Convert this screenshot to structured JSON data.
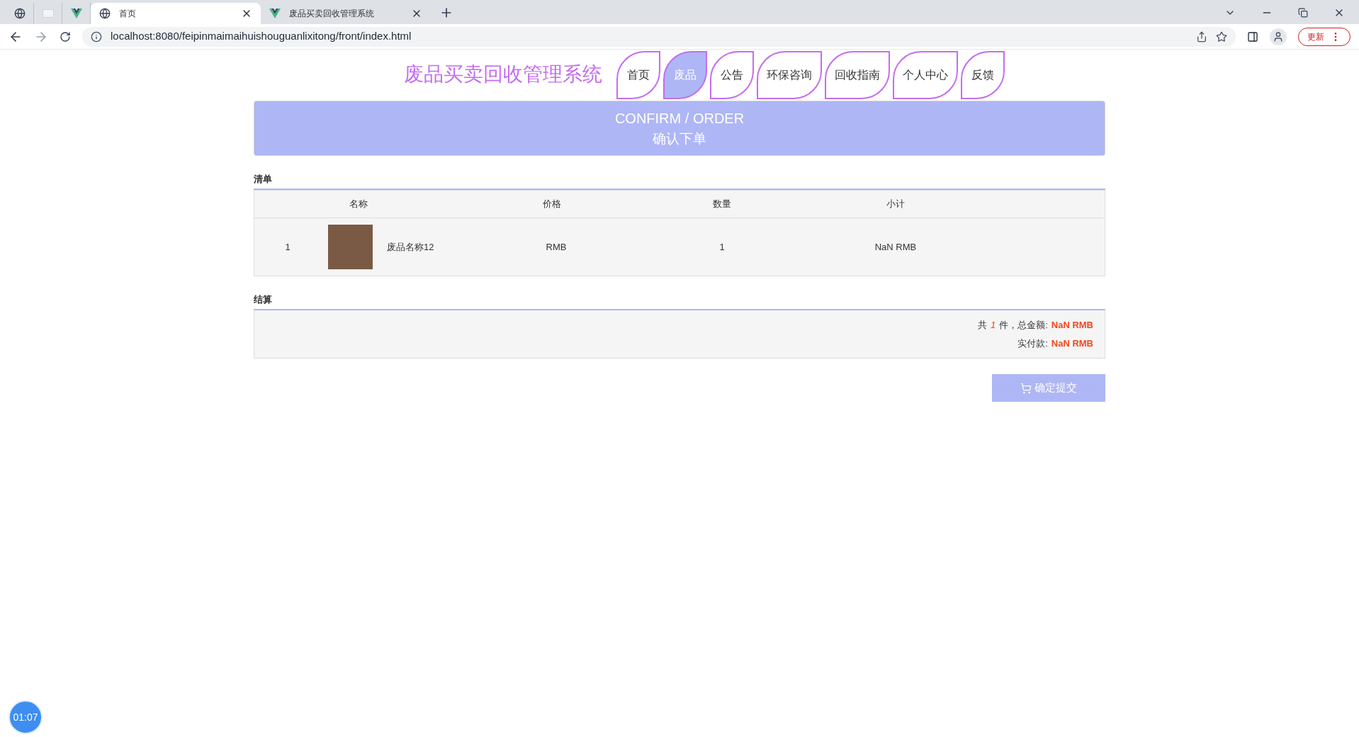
{
  "browser": {
    "tabs": [
      {
        "kind": "globe",
        "selected": false
      },
      {
        "kind": "page",
        "selected": false
      },
      {
        "kind": "vue",
        "selected": false
      },
      {
        "kind": "globe",
        "title": "首页",
        "selected": true
      },
      {
        "kind": "vue",
        "title": "废品买卖回收管理系统",
        "selected": false
      }
    ],
    "address": "localhost:8080/feipinmaimaihuishouguanlixitong/front/index.html",
    "update_label": "更新"
  },
  "site_title": "废品买卖回收管理系统",
  "nav": [
    {
      "label": "首页",
      "selected": false
    },
    {
      "label": "废品",
      "selected": true
    },
    {
      "label": "公告",
      "selected": false
    },
    {
      "label": "环保咨询",
      "selected": false
    },
    {
      "label": "回收指南",
      "selected": false
    },
    {
      "label": "个人中心",
      "selected": false
    },
    {
      "label": "反馈",
      "selected": false
    }
  ],
  "banner": {
    "title": "CONFIRM / ORDER",
    "subtitle": "确认下单"
  },
  "list_section": {
    "heading": "清单",
    "columns": [
      "名称",
      "价格",
      "数量",
      "小计"
    ],
    "rows": [
      {
        "index": "1",
        "name": "废品名称12",
        "price": "RMB",
        "quantity": "1",
        "subtotal": "NaN RMB"
      }
    ]
  },
  "summary_section": {
    "heading": "结算",
    "count_prefix": "共",
    "count": "1",
    "count_suffix": "件，总金额:",
    "total": "NaN RMB",
    "paid_label": "实付款:",
    "paid": "NaN RMB"
  },
  "submit_button": "确定提交",
  "timer": "01:07"
}
